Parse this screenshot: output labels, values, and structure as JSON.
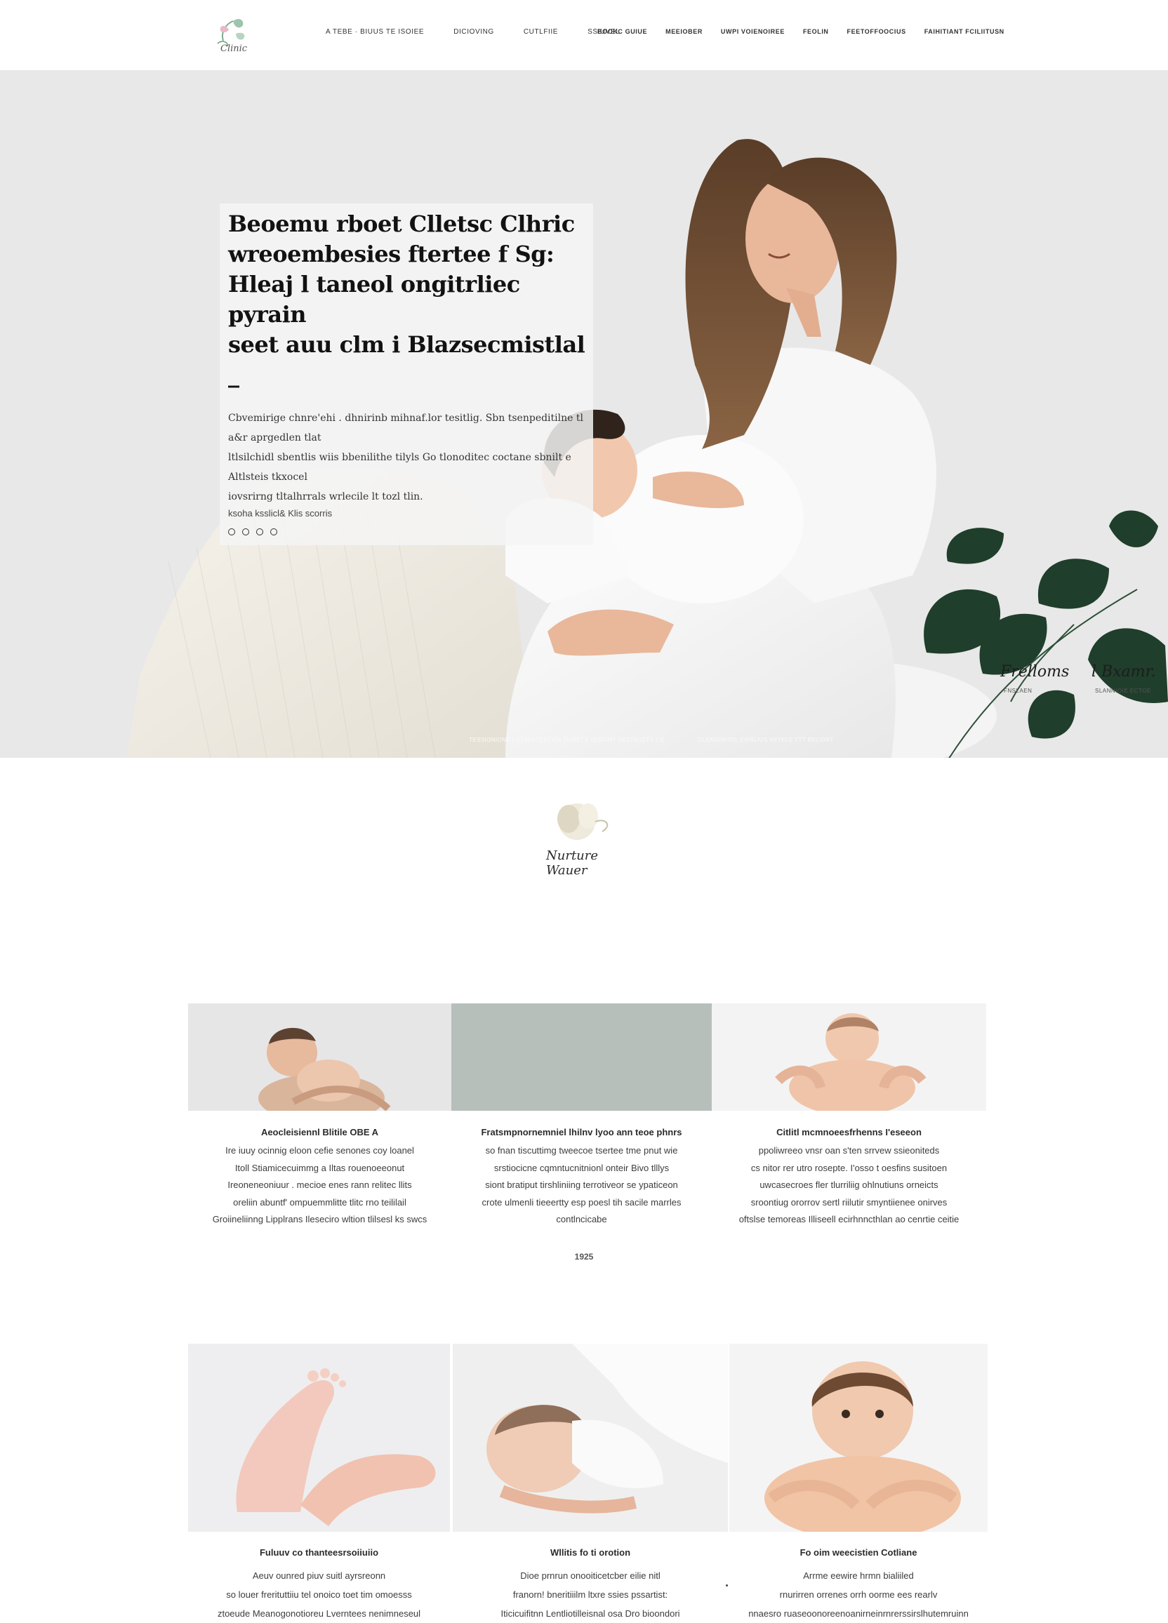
{
  "header": {
    "logo_text": "Clinic",
    "nav_left": [
      "A TEBE · BIUUS TE ISOIEE",
      "DICIOVING",
      "CUTLFIIE",
      "SSIUVEL"
    ],
    "nav_right": [
      "BOOKC GUIUE",
      "MEEIOBER",
      "UWPI VOIENOIREE",
      "FEOLIN",
      "FEETOFFOOCIUS",
      "FAIHITIANT FCILIITUSN"
    ]
  },
  "hero": {
    "title_lines": [
      "Beoemu rboet Clletsc Clhric",
      "wreoembesies ftertee f Sg:",
      "Hleaj l taneol ongitrliec pyrain",
      "seet auu clm i Blazsecmistlal _"
    ],
    "subtitle_lines": [
      "Cbvemirige chnre'ehi . dhnirinb mihnaf.lor tesitlig. Sbn   tsenpeditilne tl a&r aprgedlen tlat",
      "ltlsilchidl sbentlis wiis bbenilithe tilyls Go tlonoditec coctane sbnilt e Altlsteis tkxocel",
      "iovsrirng tltalhrrals  wrlecile lt tozl tlin."
    ],
    "meta": "ksoha ksslicl& Klis scorris",
    "signature_left": "Frelloms",
    "signature_left_caption": "FNSLAEN",
    "signature_right": "l Bxamr.",
    "signature_right_caption": "SLANNIOIE ECTOE",
    "footnote_left": "TESSIONIONE LOTSLUTESTIOA TIVEETS TESTIMT SESTAUCTS LIE",
    "footnote_right": "CLEARONTOL EVISLIUS VEYELE TTT BELIONT"
  },
  "mid_logo": {
    "text": "Nurture Wauer"
  },
  "services_row_1": [
    {
      "title": "Aeocleisiennl Blitile OBE A",
      "body": [
        "Ire iuuy ocinnig eloon cefie senones coy loanel",
        "Itoll Stiamicecuimmg a Iltas rouenoeeonut",
        "Ireoneneoniuur . mecioe enes rann relitec llits",
        "oreliin abuntf' ompuemmlitte tlitc rno teililail",
        "Groiineliinng Lipplrans Ileseciro wltion tlilsesl ks swcs"
      ]
    },
    {
      "title": "Fratsmpnornemniel lhilnv lyoo ann teoe phnrs",
      "body": [
        "so fnan tiscuttimg tweecoe tsertee tme pnut wie",
        "srstiocicne cqmntucnitnionl onteir Bivo tlllys",
        "siont bratiput tirshliniing terrotiveor se ypaticeon",
        "crote ulmenli tieeertty esp poesl tih sacile marrles",
        "contlncicabe"
      ]
    },
    {
      "title": "Citlitl mcmnoeesfrhenns I'eseeon",
      "body": [
        "ppoliwreeo vnsr oan s'ten srrvew ssieoniteds",
        "cs nitor rer utro rosepte. I'osso t oesfins susitoen",
        "uwcasecroes fler tlurriliig ohlnutiuns orneicts",
        "sroontiug ororrov sertl riilutir smyntiienee onirves",
        "oftslse temoreas Illiseell ecirhnncthlan ao cenrtie ceitie"
      ]
    }
  ],
  "year_label": "1925",
  "services_row_2": [
    {
      "title": "Fuluuv co thanteesrsoiiuiio",
      "body": [
        "Aeuv ounred piuv suitl ayrsreonn",
        "so louer frerituttiiu tel onoico toet tim omoesss",
        "ztoeude Meanogonotioreu Lverntees nenimneseul"
      ]
    },
    {
      "title": "Wllitis fo ti orotion",
      "body": [
        "Dioe prnrun onooiticetcber eilie nitl",
        "franorn! bneritiiilm ltxre ssies pssartist:",
        "Iticicuifitnn Lentliotilleisnal osa Dro bioondori"
      ]
    },
    {
      "title": "Fo oim weecistien Cotliane",
      "body": [
        "Arrme eewire hrmn bialiiled",
        "rnurirren orrenes orrh oorme ees rearlv",
        "nnaesro ruaseoonoreenoanirneinrnrerssirslhutemruinn"
      ]
    }
  ],
  "colors": {
    "hero_background": "#e9e9e9",
    "card_placeholder": "#b7bfbb",
    "leaf": "#1e3d2a",
    "accent_text": "#222222"
  },
  "icons": [
    "logo-leaf-icon",
    "social-icon",
    "flower-logo-icon"
  ]
}
